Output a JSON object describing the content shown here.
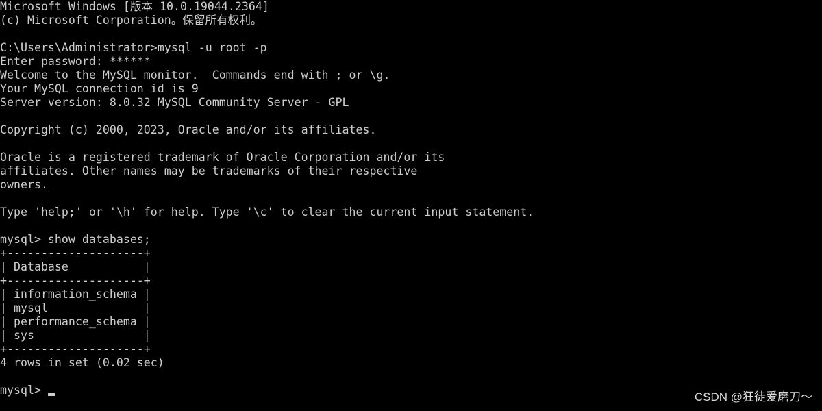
{
  "terminal": {
    "lines": [
      "Microsoft Windows [版本 10.0.19044.2364]",
      "(c) Microsoft Corporation。保留所有权利。",
      "",
      "C:\\Users\\Administrator>mysql -u root -p",
      "Enter password: ******",
      "Welcome to the MySQL monitor.  Commands end with ; or \\g.",
      "Your MySQL connection id is 9",
      "Server version: 8.0.32 MySQL Community Server - GPL",
      "",
      "Copyright (c) 2000, 2023, Oracle and/or its affiliates.",
      "",
      "Oracle is a registered trademark of Oracle Corporation and/or its",
      "affiliates. Other names may be trademarks of their respective",
      "owners.",
      "",
      "Type 'help;' or '\\h' for help. Type '\\c' to clear the current input statement.",
      "",
      "mysql> show databases;",
      "+--------------------+",
      "| Database           |",
      "+--------------------+",
      "| information_schema |",
      "| mysql              |",
      "| performance_schema |",
      "| sys                |",
      "+--------------------+",
      "4 rows in set (0.02 sec)",
      "",
      "mysql> "
    ]
  },
  "watermark": "CSDN @狂徒爱磨刀～",
  "colors": {
    "background": "#000000",
    "text": "#cccccc"
  }
}
